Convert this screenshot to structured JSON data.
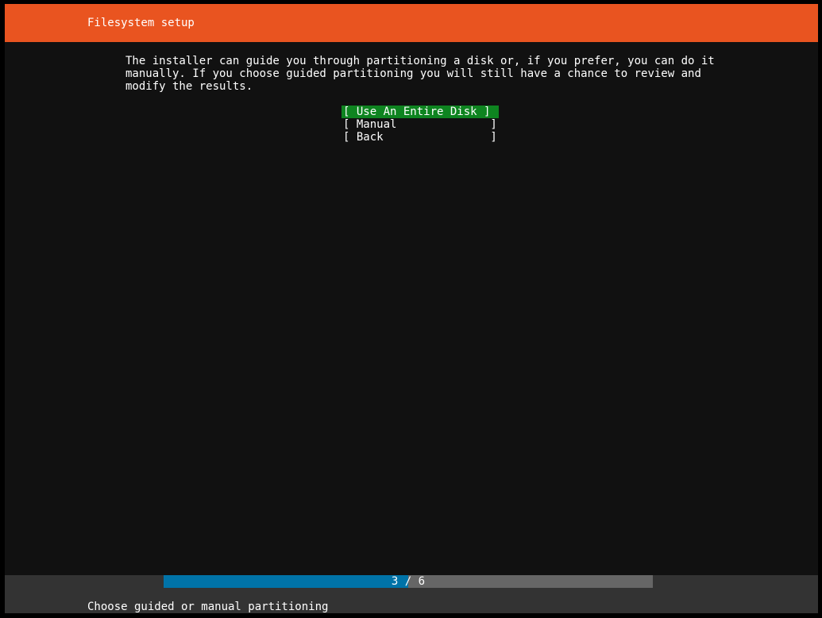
{
  "header": {
    "title": "Filesystem setup"
  },
  "body": {
    "lines": [
      "The installer can guide you through partitioning a disk or, if you prefer, you can do it",
      "manually. If you choose guided partitioning you will still have a chance to review and",
      "modify the results."
    ]
  },
  "menu": {
    "items": [
      {
        "label": "[ Use An Entire Disk ]",
        "selected": true
      },
      {
        "label": "[ Manual              ]",
        "selected": false
      },
      {
        "label": "[ Back                ]",
        "selected": false
      }
    ]
  },
  "footer": {
    "progress": {
      "current": 3,
      "total": 6,
      "label": "3 / 6"
    },
    "status": "Choose guided or manual partitioning"
  },
  "colors": {
    "header_bg": "#e95420",
    "selected_bg": "#0e8420",
    "progress_fill": "#0073a8",
    "progress_track": "#666666",
    "footer_bg": "#333333",
    "screen_bg": "#111111"
  }
}
